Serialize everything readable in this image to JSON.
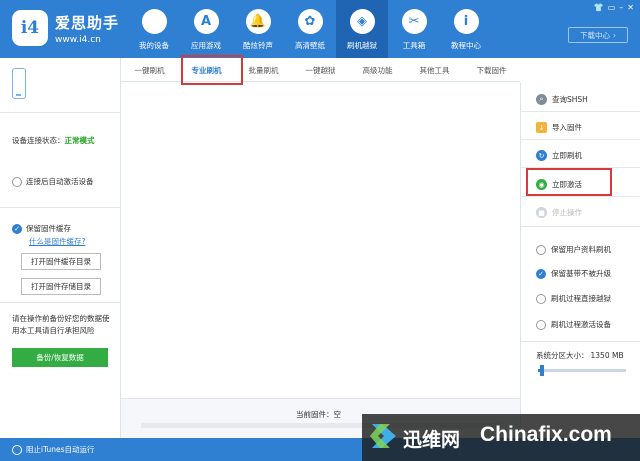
{
  "app": {
    "logo_text": "i4",
    "name": "爱思助手",
    "url": "www.i4.cn"
  },
  "window_controls": [
    "👕",
    "▭",
    "–",
    "✕"
  ],
  "nav": [
    {
      "label": "我的设备",
      "icon": ""
    },
    {
      "label": "应用游戏",
      "icon": "A"
    },
    {
      "label": "酷炫铃声",
      "icon": "🔔"
    },
    {
      "label": "高清壁纸",
      "icon": "✿"
    },
    {
      "label": "刷机越狱",
      "icon": "◈",
      "active": true
    },
    {
      "label": "工具箱",
      "icon": "✂"
    },
    {
      "label": "教程中心",
      "icon": "i"
    }
  ],
  "download_center": "下载中心",
  "left": {
    "status_label": "设备连接状态：",
    "status_value": "正常模式",
    "auto_activate": "连接后自动激活设备",
    "keep_cache": "保留固件缓存",
    "what_is_cache": "什么是固件缓存?",
    "open_cache_dir": "打开固件缓存目录",
    "open_store_dir": "打开固件存储目录",
    "warning": "请在操作前备份好您的数据使用本工具请自行承担风险",
    "backup_button": "备份/恢复数据"
  },
  "tabs": [
    {
      "label": "一键刷机"
    },
    {
      "label": "专业刷机",
      "active": true
    },
    {
      "label": "批量刷机"
    },
    {
      "label": "一键越狱"
    },
    {
      "label": "高级功能"
    },
    {
      "label": "其他工具"
    },
    {
      "label": "下载固件"
    }
  ],
  "main": {
    "current_firmware": "当前固件：空"
  },
  "right": {
    "query_shsh": "查询SHSH",
    "import_firmware": "导入固件",
    "flash_now": "立即刷机",
    "activate_now": "立即激活",
    "stop_operation": "停止操作",
    "options": [
      {
        "label": "保留用户资料刷机",
        "checked": false
      },
      {
        "label": "保留基带不被升级",
        "checked": true
      },
      {
        "label": "刷机过程直接越狱",
        "checked": false
      },
      {
        "label": "刷机过程激活设备",
        "checked": false
      }
    ],
    "partition_label": "系统分区大小：",
    "partition_value": "1350 MB",
    "partition_level": 0.05
  },
  "statusbar": {
    "itunes_label": "阻止iTunes自动运行"
  },
  "watermark": {
    "cn": "迅维网",
    "en": "Chinafix.com"
  },
  "colors": {
    "brand_blue": "#2f7fd3",
    "highlight_red": "#d63b3b",
    "ok_green": "#2aa52a",
    "button_green": "#34ac44"
  }
}
